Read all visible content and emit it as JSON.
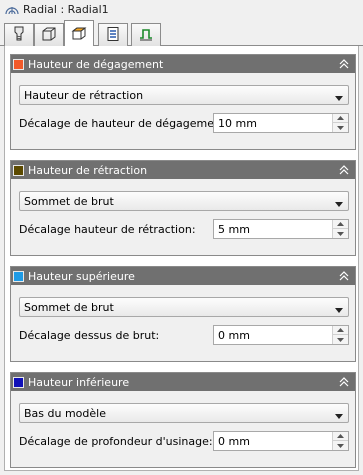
{
  "window": {
    "title": "Radial : Radial1"
  },
  "tabs": [
    {
      "icon": "tool-icon",
      "active": false
    },
    {
      "icon": "stock-cube-icon",
      "active": false
    },
    {
      "icon": "heights-cube-icon",
      "active": true
    },
    {
      "icon": "passes-icon",
      "active": false
    },
    {
      "icon": "linking-icon",
      "active": false
    }
  ],
  "sections": [
    {
      "title": "Hauteur de dégagement",
      "color": "#f25a2a",
      "select_value": "Hauteur de rétraction",
      "offset_label": "Décalage de hauteur de dégagement:",
      "offset_value": "10 mm"
    },
    {
      "title": "Hauteur de rétraction",
      "color": "#5c4a00",
      "select_value": "Sommet de brut",
      "offset_label": "Décalage hauteur de rétraction:",
      "offset_value": "5 mm"
    },
    {
      "title": "Hauteur supérieure",
      "color": "#1e9be6",
      "select_value": "Sommet de brut",
      "offset_label": "Décalage dessus de brut:",
      "offset_value": "0 mm"
    },
    {
      "title": "Hauteur inférieure",
      "color": "#1010b8",
      "select_value": "Bas du modèle",
      "offset_label": "Décalage de profondeur d'usinage:",
      "offset_value": "0 mm"
    }
  ]
}
